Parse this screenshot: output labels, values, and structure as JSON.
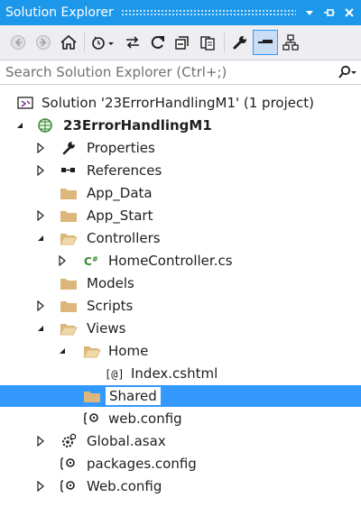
{
  "window": {
    "title": "Solution Explorer"
  },
  "search": {
    "placeholder": "Search Solution Explorer (Ctrl+;)"
  },
  "colors": {
    "titlebar": "#1c97ea",
    "selection": "#3399ff",
    "folder": "#dcb67a",
    "csharp": "#368832"
  },
  "toolbar": {
    "buttons": [
      "back-icon",
      "forward-icon",
      "home-icon",
      "pending-changes-icon",
      "sync-icon",
      "refresh-icon",
      "collapse-all-icon",
      "show-all-files-icon",
      "properties-icon",
      "preview-icon",
      "view-class-diagram-icon"
    ]
  },
  "tree": {
    "solution": "Solution '23ErrorHandlingM1' (1 project)",
    "project": "23ErrorHandlingM1",
    "properties": "Properties",
    "references": "References",
    "app_data": "App_Data",
    "app_start": "App_Start",
    "controllers": "Controllers",
    "home_controller": "HomeController.cs",
    "models": "Models",
    "scripts": "Scripts",
    "views": "Views",
    "home": "Home",
    "index": "Index.cshtml",
    "shared": "Shared",
    "views_web_config": "web.config",
    "global_asax": "Global.asax",
    "packages_config": "packages.config",
    "web_config": "Web.config"
  }
}
